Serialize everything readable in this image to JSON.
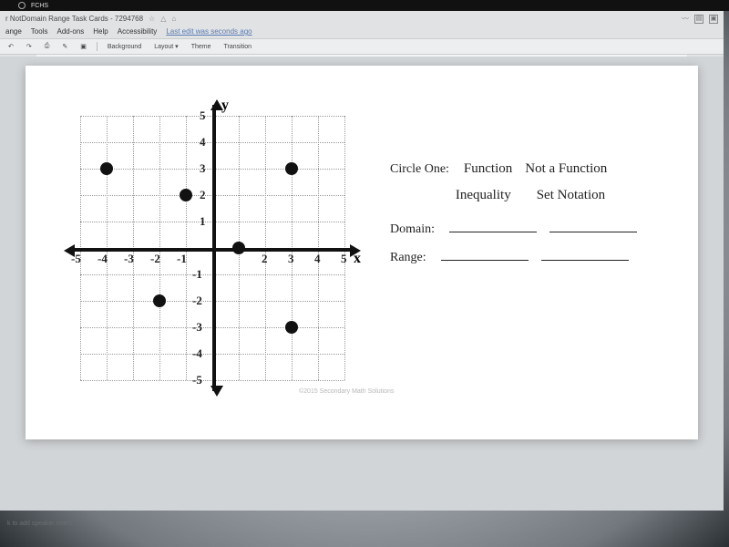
{
  "taskbar": {
    "app": "FCHS"
  },
  "title": "r NotDomain Range Task Cards - 7294768",
  "title_icons": {
    "star": "☆",
    "cloud": "△",
    "drive": "⌂"
  },
  "menus": [
    "ange",
    "Tools",
    "Add-ons",
    "Help",
    "Accessibility"
  ],
  "last_edit": "Last edit was seconds ago",
  "toolbar": {
    "undo": "↶",
    "redo": "↷",
    "print": "⎙",
    "paint": "✎",
    "present": "▣",
    "background": "Background",
    "layout": "Layout ▾",
    "theme": "Theme",
    "transition": "Transition"
  },
  "chart_data": {
    "type": "scatter",
    "xlabel": "x",
    "ylabel": "y",
    "xlim": [
      -5,
      5
    ],
    "ylim": [
      -5,
      5
    ],
    "xticks": [
      -5,
      -4,
      -3,
      -2,
      -1,
      2,
      3,
      4,
      5
    ],
    "yticks": [
      5,
      4,
      3,
      2,
      1,
      -1,
      -2,
      -3,
      -4,
      -5
    ],
    "points": [
      {
        "x": -4,
        "y": 3
      },
      {
        "x": -1,
        "y": 2
      },
      {
        "x": 1,
        "y": 0
      },
      {
        "x": 3,
        "y": 3
      },
      {
        "x": -2,
        "y": -2
      },
      {
        "x": 3,
        "y": -3
      }
    ],
    "copyright": "©2015 Secondary Math Solutions"
  },
  "worksheet": {
    "circle_one_label": "Circle One:",
    "options": {
      "function": "Function",
      "not_function": "Not a Function"
    },
    "headers": {
      "inequality": "Inequality",
      "set_notation": "Set Notation"
    },
    "domain_label": "Domain:",
    "range_label": "Range:"
  },
  "notes_placeholder": "k to add speaker notes"
}
